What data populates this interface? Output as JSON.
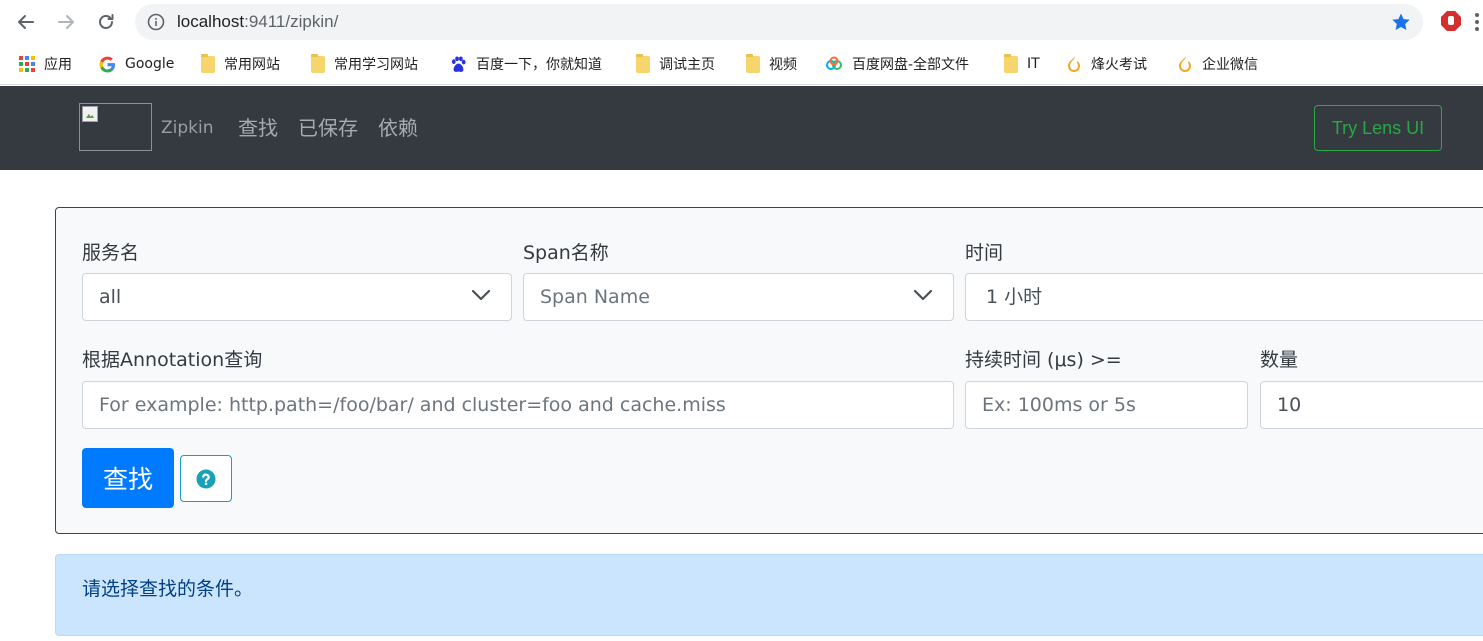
{
  "browser": {
    "url_host": "localhost",
    "url_rest": ":9411/zipkin/",
    "accent_color": "#1a73e8",
    "bookmarks": [
      {
        "label": "应用",
        "icon": "apps-grid-icon"
      },
      {
        "label": "Google",
        "icon": "google-icon"
      },
      {
        "label": "常用网站",
        "icon": "folder-icon"
      },
      {
        "label": "常用学习网站",
        "icon": "folder-icon"
      },
      {
        "label": "百度一下，你就知道",
        "icon": "baidu-paw-icon"
      },
      {
        "label": "调试主页",
        "icon": "folder-icon"
      },
      {
        "label": "视频",
        "icon": "folder-icon"
      },
      {
        "label": "百度网盘-全部文件",
        "icon": "baidu-cloud-icon"
      },
      {
        "label": "IT",
        "icon": "folder-icon"
      },
      {
        "label": "烽火考试",
        "icon": "flame-icon"
      },
      {
        "label": "企业微信",
        "icon": "flame-icon"
      }
    ]
  },
  "navbar": {
    "brand": "Zipkin",
    "links": [
      "查找",
      "已保存",
      "依赖"
    ],
    "lens_button": "Try Lens UI",
    "lens_color": "#28a745",
    "background": "#343a40"
  },
  "search_form": {
    "service_label": "服务名",
    "service_value": "all",
    "span_label": "Span名称",
    "span_placeholder": "Span Name",
    "time_label": "时间",
    "time_value": "1 小时",
    "annotation_label": "根据Annotation查询",
    "annotation_placeholder": "For example: http.path=/foo/bar/ and cluster=foo and cache.miss",
    "duration_label": "持续时间 (μs) >=",
    "duration_placeholder": "Ex: 100ms or 5s",
    "limit_label": "数量",
    "limit_value": "10",
    "search_button": "查找",
    "help_icon": "question-circle-icon",
    "primary_color": "#007bff",
    "info_color": "#17a2b8"
  },
  "alert": {
    "message": "请选择查找的条件。",
    "background": "#cce5ff"
  }
}
